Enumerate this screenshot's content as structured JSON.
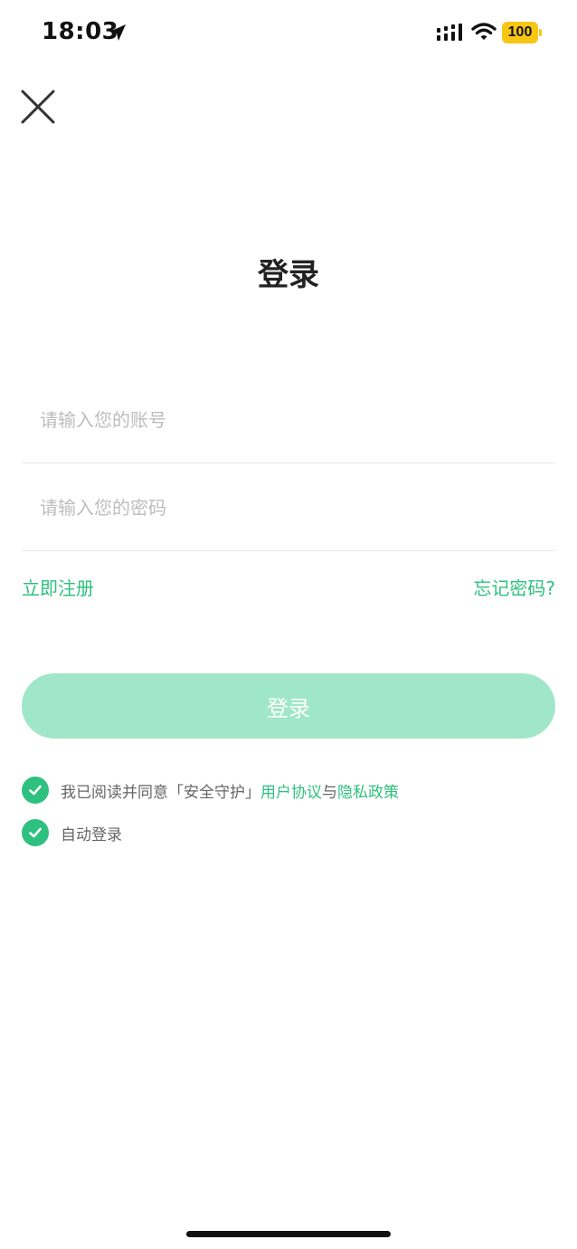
{
  "status_bar": {
    "time": "18:03",
    "battery": "100",
    "battery_color": "#f7c615"
  },
  "icons": {
    "close": "close-icon",
    "location": "location-arrow-icon",
    "signal": "cellular-signal-icon",
    "wifi": "wifi-icon",
    "check": "checkmark-icon"
  },
  "page": {
    "title": "登录"
  },
  "form": {
    "account_placeholder": "请输入您的账号",
    "account_value": "",
    "password_placeholder": "请输入您的密码",
    "password_value": ""
  },
  "links": {
    "register": "立即注册",
    "forgot_password": "忘记密码?"
  },
  "login_button": {
    "label": "登录",
    "state": "disabled"
  },
  "agreement": {
    "checked": true,
    "prefix": "我已阅读并同意「安全守护」",
    "user_agreement": "用户协议",
    "connector": "与",
    "privacy_policy": "隐私政策"
  },
  "auto_login": {
    "checked": true,
    "label": "自动登录"
  },
  "colors": {
    "accent": "#2ec07f",
    "button_disabled": "#a0e7c9",
    "placeholder": "#bdbdbd",
    "divider": "#e6e6e6"
  }
}
